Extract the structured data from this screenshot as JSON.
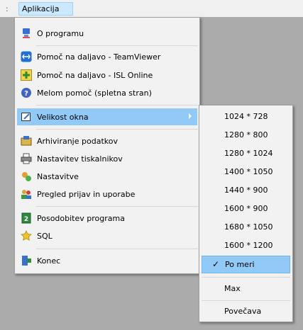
{
  "menubar": {
    "grip": ":",
    "active_menu": "Aplikacija"
  },
  "main_menu": {
    "items": [
      {
        "label": "O programu",
        "icon": "info-icon"
      },
      {
        "label": "Pomoč na daljavo - TeamViewer",
        "icon": "teamviewer-icon"
      },
      {
        "label": "Pomoč na daljavo - ISL Online",
        "icon": "isl-online-icon"
      },
      {
        "label": "Melom pomoč (spletna stran)",
        "icon": "help-icon"
      },
      {
        "label": "Velikost okna",
        "icon": "window-size-icon"
      },
      {
        "label": "Arhiviranje podatkov",
        "icon": "archive-icon"
      },
      {
        "label": "Nastavitev tiskalnikov",
        "icon": "printer-icon"
      },
      {
        "label": "Nastavitve",
        "icon": "settings-icon"
      },
      {
        "label": "Pregled prijav in uporabe",
        "icon": "users-icon"
      },
      {
        "label": "Posodobitev programa",
        "icon": "update-icon"
      },
      {
        "label": "SQL",
        "icon": "sql-icon"
      },
      {
        "label": "Konec",
        "icon": "exit-icon"
      }
    ]
  },
  "window_size_menu": {
    "items": [
      {
        "label": "1024 * 728"
      },
      {
        "label": "1280 * 800"
      },
      {
        "label": "1280 * 1024"
      },
      {
        "label": "1400 * 1050"
      },
      {
        "label": "1440 * 900"
      },
      {
        "label": "1600 * 900"
      },
      {
        "label": "1680 * 1050"
      },
      {
        "label": "1600 * 1200"
      },
      {
        "label": "Po meri",
        "checked": true
      },
      {
        "label": "Max"
      },
      {
        "label": "Povečava"
      }
    ]
  },
  "colors": {
    "highlight": "#91c9f7",
    "menubar_active": "#cce8ff",
    "background": "#ababab"
  }
}
